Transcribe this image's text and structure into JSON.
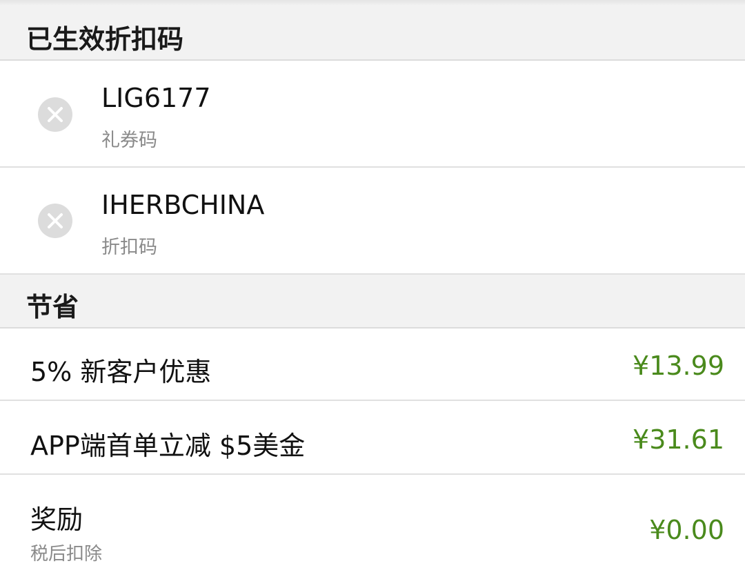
{
  "coupons_section": {
    "title": "已生效折扣码",
    "items": [
      {
        "code": "LIG6177",
        "type": "礼券码",
        "icon": "close-circle-icon"
      },
      {
        "code": "IHERBCHINA",
        "type": "折扣码",
        "icon": "close-circle-icon"
      }
    ]
  },
  "savings_section": {
    "title": "节省",
    "items": [
      {
        "label": "5% 新客户优惠",
        "amount": "¥13.99"
      },
      {
        "label": "APP端首单立减 $5美金",
        "amount": "¥31.61"
      },
      {
        "label": "奖励",
        "sublabel": "税后扣除",
        "amount": "¥0.00"
      }
    ]
  },
  "colors": {
    "amount": "#4a8a1c",
    "secondary_text": "#8a8a8a",
    "section_bg": "#f2f2f2",
    "remove_icon_bg": "#dcdcdc"
  }
}
